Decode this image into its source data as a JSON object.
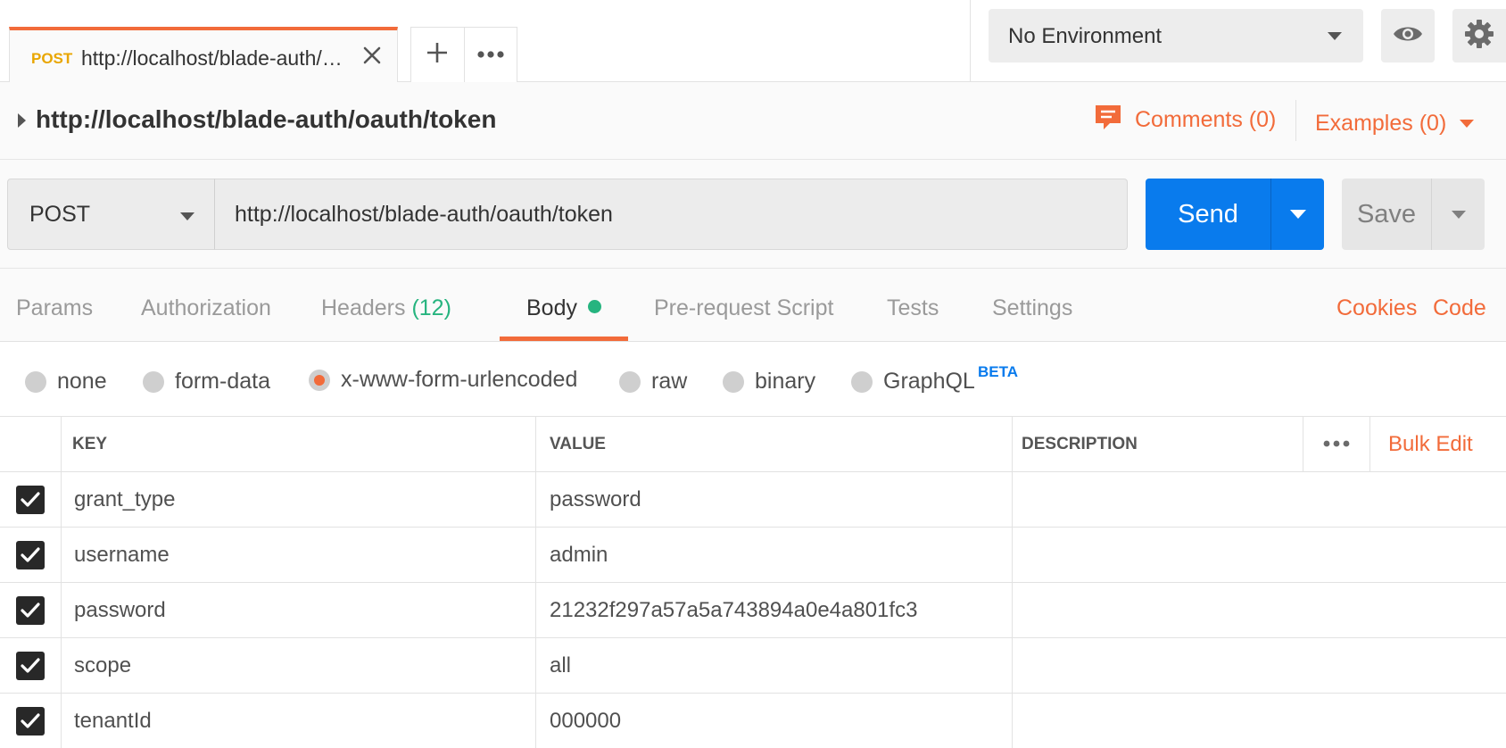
{
  "tab": {
    "method": "POST",
    "url": "http://localhost/blade-auth/o..."
  },
  "environment": {
    "selected": "No Environment"
  },
  "request": {
    "title": "http://localhost/blade-auth/oauth/token",
    "comments_label": "Comments (0)",
    "examples_label": "Examples (0)",
    "method": "POST",
    "url": "http://localhost/blade-auth/oauth/token",
    "send_label": "Send",
    "save_label": "Save"
  },
  "sections": {
    "params": "Params",
    "authorization": "Authorization",
    "headers": "Headers",
    "headers_count": "(12)",
    "body": "Body",
    "prerequest": "Pre-request Script",
    "tests": "Tests",
    "settings": "Settings",
    "cookies": "Cookies",
    "code": "Code"
  },
  "body_types": {
    "none": "none",
    "form_data": "form-data",
    "urlencoded": "x-www-form-urlencoded",
    "raw": "raw",
    "binary": "binary",
    "graphql": "GraphQL",
    "beta": "BETA",
    "selected": "x-www-form-urlencoded"
  },
  "table": {
    "headers": {
      "key": "KEY",
      "value": "VALUE",
      "description": "DESCRIPTION",
      "bulk_edit": "Bulk Edit"
    },
    "rows": [
      {
        "checked": true,
        "key": "grant_type",
        "value": "password",
        "description": ""
      },
      {
        "checked": true,
        "key": "username",
        "value": "admin",
        "description": ""
      },
      {
        "checked": true,
        "key": "password",
        "value": "21232f297a57a5a743894a0e4a801fc3",
        "description": ""
      },
      {
        "checked": true,
        "key": "scope",
        "value": "all",
        "description": ""
      },
      {
        "checked": true,
        "key": "tenantId",
        "value": "000000",
        "description": ""
      }
    ]
  },
  "colors": {
    "accent": "#f26b3a",
    "send": "#097bed",
    "success": "#26b47f",
    "method_post": "#e9a600"
  }
}
